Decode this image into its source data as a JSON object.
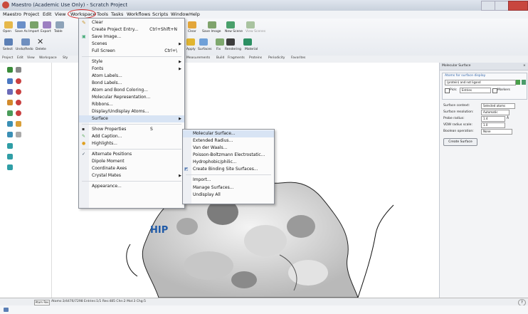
{
  "window": {
    "title": "Maestro (Academic Use Only) - Scratch Project"
  },
  "menubar": [
    "Maestro",
    "Project",
    "Edit",
    "View",
    "Workspace",
    "Tools",
    "Tasks",
    "Workflows",
    "Scripts",
    "Window",
    "Help"
  ],
  "toolbar": {
    "row1": [
      "Open",
      "Save As",
      "Import",
      "Export",
      "Table"
    ],
    "row2": [
      "Select",
      "Undo/Redo",
      "Delete"
    ],
    "right_row1": [
      "Clear",
      "Save Image",
      "New Scene",
      "View Scenes"
    ],
    "right_row2": [
      "Apply",
      "Surfaces",
      "Fix",
      "Rendering",
      "Material"
    ],
    "tabs_left": [
      "Project",
      "Edit",
      "View",
      "Workspace",
      "Sty"
    ],
    "tabs_right": [
      "Measurements",
      "Build",
      "Fragments",
      "Proteins",
      "Periodicity",
      "Favorites"
    ]
  },
  "workspace_menu": {
    "items": [
      {
        "label": "Clear",
        "shortcut": "",
        "arrow": false
      },
      {
        "label": "Create Project Entry...",
        "shortcut": "Ctrl+Shift+N",
        "arrow": false
      },
      {
        "label": "Save Image...",
        "shortcut": "",
        "arrow": false
      },
      {
        "label": "Scenes",
        "shortcut": "",
        "arrow": true
      },
      {
        "label": "Full Screen",
        "shortcut": "Ctrl+\\",
        "arrow": false
      },
      {
        "label": "Style",
        "shortcut": "",
        "arrow": true
      },
      {
        "label": "Fonts",
        "shortcut": "",
        "arrow": true
      },
      {
        "label": "Atom Labels...",
        "shortcut": "",
        "arrow": false
      },
      {
        "label": "Bond Labels...",
        "shortcut": "",
        "arrow": false
      },
      {
        "label": "Atom and Bond Coloring...",
        "shortcut": "",
        "arrow": false
      },
      {
        "label": "Molecular Representation...",
        "shortcut": "",
        "arrow": false
      },
      {
        "label": "Ribbons...",
        "shortcut": "",
        "arrow": false
      },
      {
        "label": "Display/Undisplay Atoms...",
        "shortcut": "",
        "arrow": false
      },
      {
        "label": "Surface",
        "shortcut": "",
        "arrow": true
      },
      {
        "label": "Show Properties",
        "shortcut": "S",
        "arrow": false
      },
      {
        "label": "Add Caption...",
        "shortcut": "",
        "arrow": false
      },
      {
        "label": "Highlights...",
        "shortcut": "",
        "arrow": false
      },
      {
        "label": "Alternate Positions",
        "shortcut": "",
        "arrow": false
      },
      {
        "label": "Dipole Moment",
        "shortcut": "",
        "arrow": false
      },
      {
        "label": "Coordinate Axes",
        "shortcut": "",
        "arrow": false
      },
      {
        "label": "Crystal Mates",
        "shortcut": "",
        "arrow": true
      },
      {
        "label": "Appearance...",
        "shortcut": "",
        "arrow": false
      }
    ]
  },
  "surface_submenu": {
    "items": [
      "Molecular Surface...",
      "Extended Radius...",
      "Van der Waals...",
      "Poisson-Boltzmann Electrostatic...",
      "Hydrophobic/philic...",
      "Create Binding Site Surfaces...",
      "Import...",
      "Manage Surfaces...",
      "Undisplay All"
    ]
  },
  "viewer": {
    "label": "HIP"
  },
  "panel": {
    "title": "Molecular Surface",
    "atoms_header": "Atoms for surface display",
    "asl": "(protein) and not ligand",
    "pick_label": "Pick:",
    "pick_value": "Entries",
    "markers_label": "Markers",
    "rows": [
      {
        "label": "Surface context:",
        "value": "Selected atoms"
      },
      {
        "label": "Surface resolution:",
        "value": "Automatic"
      },
      {
        "label": "Probe radius:",
        "value": "1.4",
        "unit": "Å"
      },
      {
        "label": "VDW radius scale:",
        "value": "1.0"
      },
      {
        "label": "Boolean operation:",
        "value": "None"
      }
    ],
    "create_button": "Create Surface"
  },
  "status": {
    "button": "Atom Res",
    "text": "Atoms:3/4476/7298 Entries:1/1 Res:485 Chn:2 Mol:3 Chg:5"
  },
  "colors": {
    "highlight_ring": "#d62a2a",
    "hip_label": "#1f5aa8",
    "menu_hover": "#d8e4f4"
  }
}
